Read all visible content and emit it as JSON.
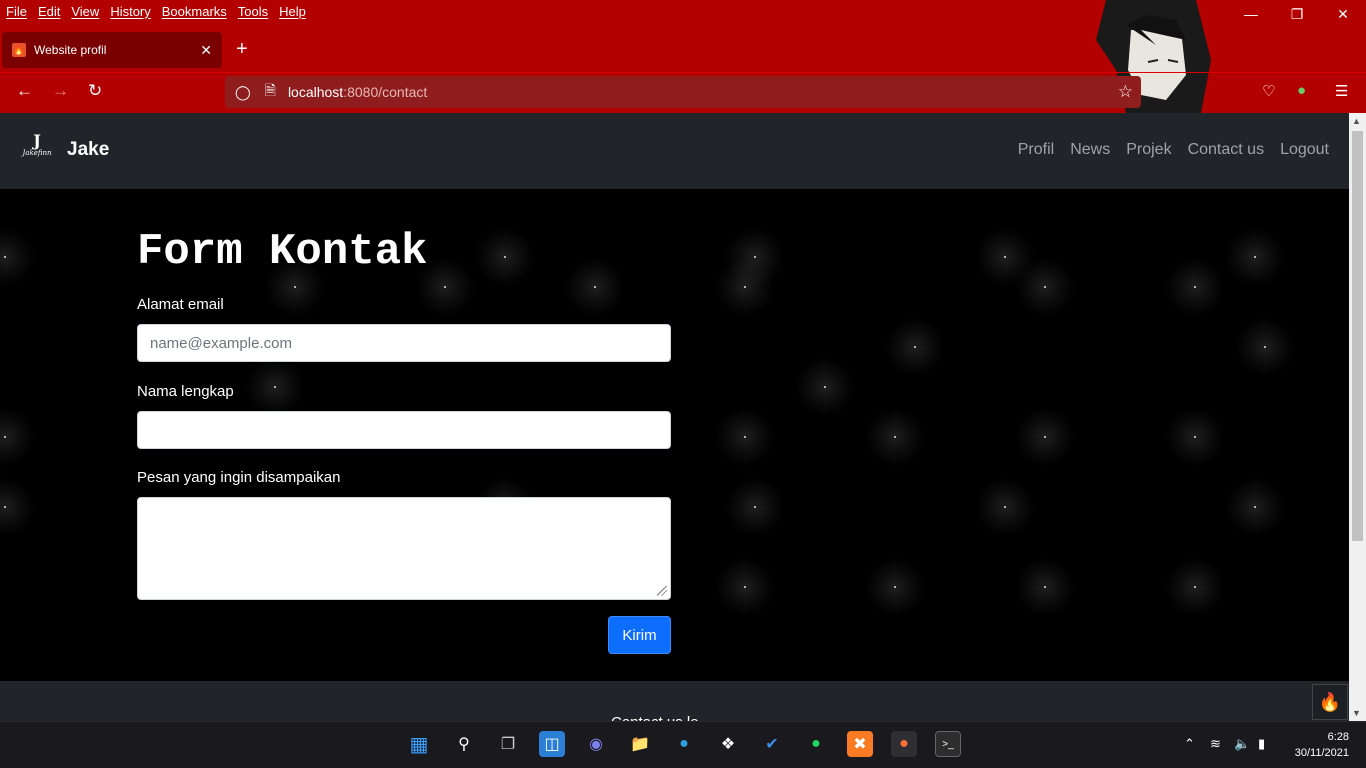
{
  "browser": {
    "menu": [
      "File",
      "Edit",
      "View",
      "History",
      "Bookmarks",
      "Tools",
      "Help"
    ],
    "tab_title": "Website profil",
    "url_host": "localhost",
    "url_path": ":8080/contact"
  },
  "site": {
    "brand_logo_text": "Jakefinn",
    "brand_name": "Jake",
    "nav_links": [
      "Profil",
      "News",
      "Projek",
      "Contact us",
      "Logout"
    ]
  },
  "form": {
    "title": "Form Kontak",
    "email_label": "Alamat email",
    "email_placeholder": "name@example.com",
    "name_label": "Nama lengkap",
    "message_label": "Pesan yang ingin disampaikan",
    "submit_label": "Kirim"
  },
  "footer": {
    "text": "Contact us le"
  },
  "taskbar": {
    "time": "6:28",
    "date": "30/11/2021"
  },
  "colors": {
    "chrome_red": "#b30000",
    "navbar_bg": "#212529",
    "button_blue": "#0d6efd"
  }
}
